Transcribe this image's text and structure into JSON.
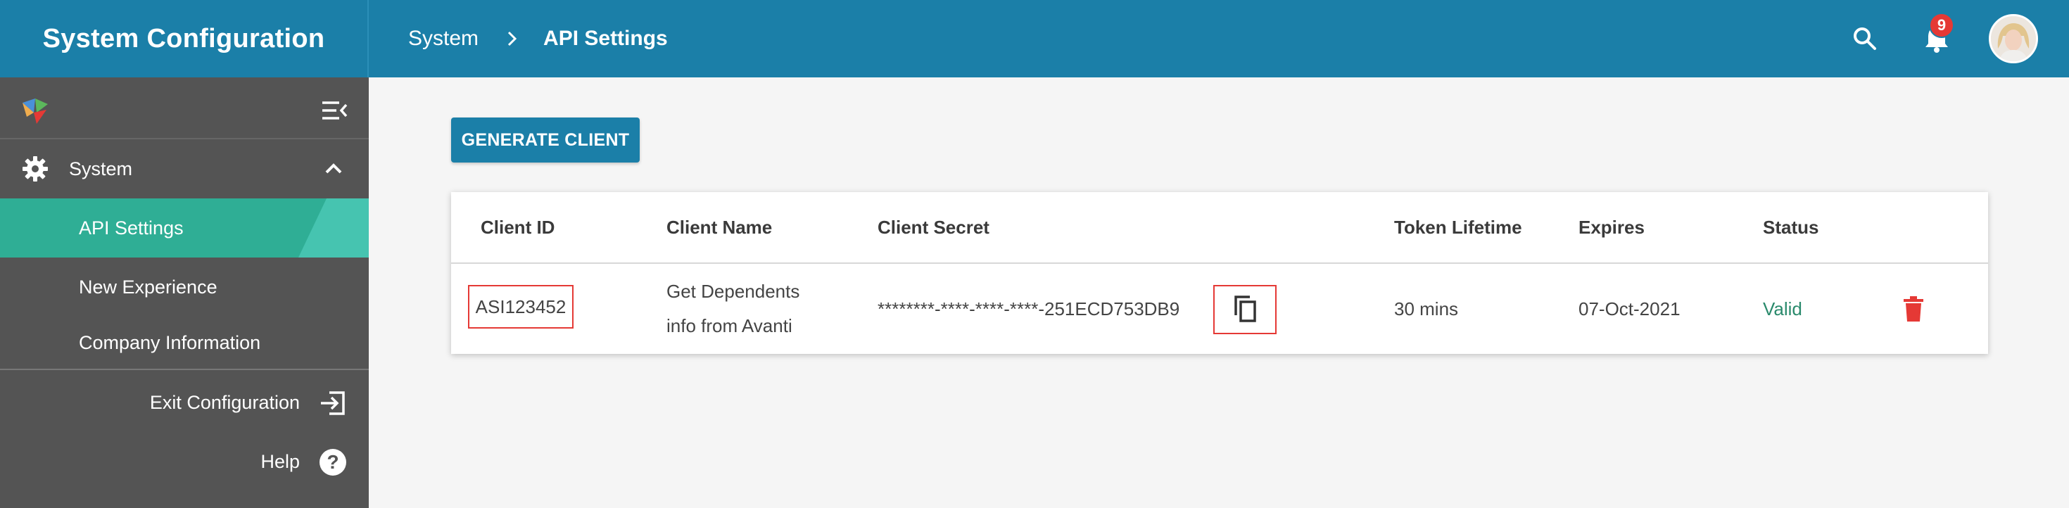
{
  "header": {
    "title": "System Configuration",
    "breadcrumb": [
      "System",
      "API Settings"
    ],
    "notifications_count": "9",
    "icons": [
      "search-icon",
      "bell-icon",
      "avatar"
    ]
  },
  "sidebar": {
    "section": "System",
    "items": [
      {
        "label": "API Settings",
        "active": true
      },
      {
        "label": "New Experience"
      },
      {
        "label": "Company Information"
      }
    ],
    "exit_label": "Exit Configuration",
    "help_label": "Help",
    "help_icon_text": "?"
  },
  "main": {
    "generate_button": "GENERATE CLIENT",
    "table": {
      "columns": [
        "Client ID",
        "Client Name",
        "Client Secret",
        "Token Lifetime",
        "Expires",
        "Status"
      ],
      "rows": [
        {
          "client_id": "ASI123452",
          "client_name_line1": "Get Dependents",
          "client_name_line2": "info from Avanti",
          "client_secret": "********-****-****-****-251ECD753DB9",
          "token_lifetime": "30 mins",
          "expires": "07-Oct-2021",
          "status": "Valid"
        }
      ]
    }
  },
  "colors": {
    "header": "#1b7fa8",
    "sidebar": "#545454",
    "active_item": "#2fae95",
    "status_valid": "#2a8a6c",
    "delete": "#e53935",
    "highlight_box": "#e53935"
  }
}
